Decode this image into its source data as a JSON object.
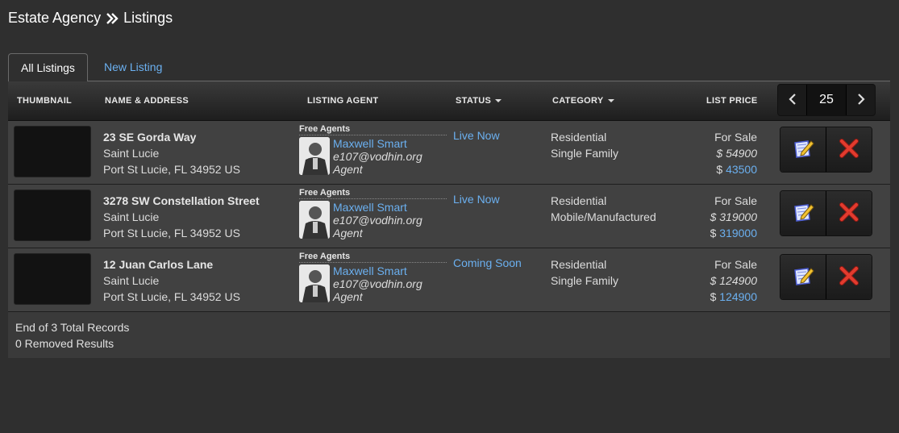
{
  "breadcrumb": {
    "root": "Estate Agency",
    "current": "Listings"
  },
  "tabs": [
    {
      "label": "All Listings",
      "active": true
    },
    {
      "label": "New Listing",
      "active": false
    }
  ],
  "table": {
    "headers": {
      "thumbnail": "Thumbnail",
      "name_address": "Name & Address",
      "listing_agent": "Listing Agent",
      "status": "Status",
      "category": "Category",
      "list_price": "List Price"
    },
    "page_size": "25",
    "rows": [
      {
        "street": "23 SE Gorda Way",
        "area": "Saint Lucie",
        "city": "Port St Lucie, FL 34952 US",
        "agent_group": "Free Agents",
        "agent_name": "Maxwell Smart",
        "agent_email": "e107@vodhin.org",
        "agent_role": "Agent",
        "status": "Live Now",
        "category_main": "Residential",
        "category_sub": "Single Family",
        "price_type": "For Sale",
        "price_original": "$ 54900",
        "price_symbol": "$",
        "price_current": "43500"
      },
      {
        "street": "3278 SW Constellation Street",
        "area": "Saint Lucie",
        "city": "Port St Lucie, FL 34952 US",
        "agent_group": "Free Agents",
        "agent_name": "Maxwell Smart",
        "agent_email": "e107@vodhin.org",
        "agent_role": "Agent",
        "status": "Live Now",
        "category_main": "Residential",
        "category_sub": "Mobile/Manufactured",
        "price_type": "For Sale",
        "price_original": "$ 319000",
        "price_symbol": "$",
        "price_current": "319000"
      },
      {
        "street": "12 Juan Carlos Lane",
        "area": "Saint Lucie",
        "city": "Port St Lucie, FL 34952 US",
        "agent_group": "Free Agents",
        "agent_name": "Maxwell Smart",
        "agent_email": "e107@vodhin.org",
        "agent_role": "Agent",
        "status": "Coming Soon",
        "category_main": "Residential",
        "category_sub": "Single Family",
        "price_type": "For Sale",
        "price_original": "$ 124900",
        "price_symbol": "$",
        "price_current": "124900"
      }
    ]
  },
  "footer": {
    "total_records": "End of 3 Total Records",
    "removed": "0 Removed Results"
  },
  "colors": {
    "link": "#6bb0f0",
    "background": "#2f2f2f",
    "row": "#414141",
    "delete_icon": "#e23b2e"
  },
  "icons": {
    "breadcrumb_separator": "double-chevron-right-icon",
    "pager_prev": "chevron-left-icon",
    "pager_next": "chevron-right-icon",
    "edit": "edit-pencil-icon",
    "delete": "delete-x-icon"
  }
}
